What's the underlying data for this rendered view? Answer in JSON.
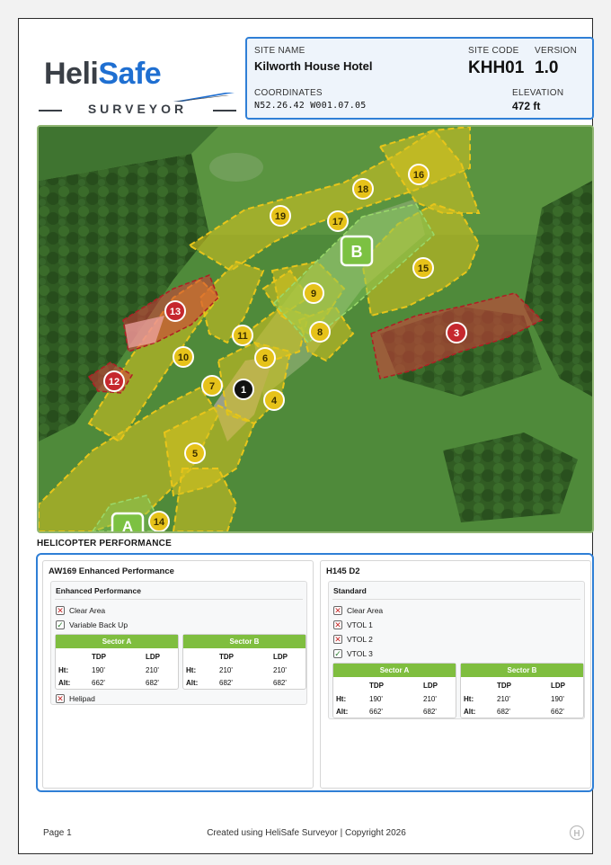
{
  "brand": {
    "name_part1": "Heli",
    "name_part2": "Safe",
    "subtitle": "SURVEYOR"
  },
  "site": {
    "name_label": "SITE NAME",
    "name": "Kilworth House Hotel",
    "code_label": "SITE CODE",
    "code": "KHH01",
    "version_label": "VERSION",
    "version": "1.0",
    "coordinates_label": "COORDINATES",
    "coordinates": "N52.26.42 W001.07.05",
    "elevation_label": "ELEVATION",
    "elevation": "472 ft"
  },
  "map": {
    "landing_sites": [
      "A",
      "B"
    ],
    "markers": [
      {
        "id": "1",
        "status": "black"
      },
      {
        "id": "3",
        "status": "red"
      },
      {
        "id": "4",
        "status": "yellow"
      },
      {
        "id": "5",
        "status": "yellow"
      },
      {
        "id": "6",
        "status": "yellow"
      },
      {
        "id": "7",
        "status": "yellow"
      },
      {
        "id": "8",
        "status": "yellow"
      },
      {
        "id": "9",
        "status": "yellow"
      },
      {
        "id": "10",
        "status": "yellow"
      },
      {
        "id": "11",
        "status": "yellow"
      },
      {
        "id": "12",
        "status": "red"
      },
      {
        "id": "13",
        "status": "red"
      },
      {
        "id": "14",
        "status": "yellow"
      },
      {
        "id": "15",
        "status": "yellow"
      },
      {
        "id": "16",
        "status": "yellow"
      },
      {
        "id": "17",
        "status": "yellow"
      },
      {
        "id": "18",
        "status": "yellow"
      },
      {
        "id": "19",
        "status": "yellow"
      }
    ],
    "colors": {
      "yellow": "#e6c21a",
      "red": "#c6282e",
      "black": "#111111",
      "landing": "#7cc142"
    }
  },
  "performance": {
    "title": "HELICOPTER PERFORMANCE",
    "helicopters": [
      {
        "name": "AW169 Enhanced Performance",
        "mode": "Enhanced Performance",
        "checks": [
          {
            "label": "Clear Area",
            "ok": false
          },
          {
            "label": "Variable Back Up",
            "ok": true
          }
        ],
        "sectors": [
          {
            "name": "Sector A",
            "col1": "TDP",
            "col2": "LDP",
            "ht_label": "Ht:",
            "alt_label": "Alt:",
            "ht": [
              "190'",
              "210'"
            ],
            "alt": [
              "662'",
              "682'"
            ]
          },
          {
            "name": "Sector B",
            "col1": "TDP",
            "col2": "LDP",
            "ht_label": "Ht:",
            "alt_label": "Alt:",
            "ht": [
              "210'",
              "210'"
            ],
            "alt": [
              "682'",
              "682'"
            ]
          }
        ],
        "after_checks": [
          {
            "label": "Helipad",
            "ok": false
          }
        ]
      },
      {
        "name": "H145 D2",
        "mode": "Standard",
        "checks": [
          {
            "label": "Clear Area",
            "ok": false
          },
          {
            "label": "VTOL 1",
            "ok": false
          },
          {
            "label": "VTOL 2",
            "ok": false
          },
          {
            "label": "VTOL 3",
            "ok": true
          }
        ],
        "sectors": [
          {
            "name": "Sector A",
            "col1": "TDP",
            "col2": "LDP",
            "ht_label": "Ht:",
            "alt_label": "Alt:",
            "ht": [
              "190'",
              "210'"
            ],
            "alt": [
              "662'",
              "682'"
            ]
          },
          {
            "name": "Sector B",
            "col1": "TDP",
            "col2": "LDP",
            "ht_label": "Ht:",
            "alt_label": "Alt:",
            "ht": [
              "210'",
              "190'"
            ],
            "alt": [
              "682'",
              "662'"
            ]
          }
        ],
        "after_checks": []
      }
    ]
  },
  "footer": {
    "page": "Page 1",
    "credit": "Created using HeliSafe Surveyor | Copyright 2026",
    "corner_icon": "helipad-h-icon"
  }
}
